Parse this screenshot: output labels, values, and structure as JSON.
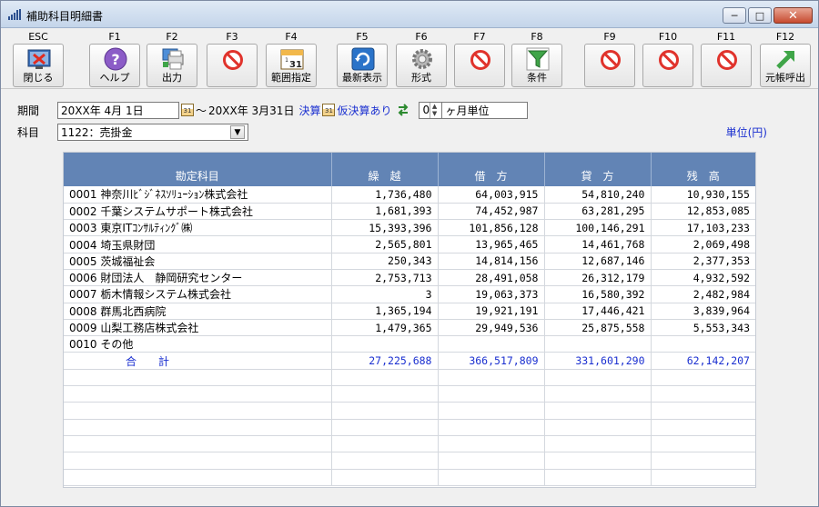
{
  "window": {
    "title": "補助科目明細書",
    "controls": {
      "minimize": "─",
      "maximize": "□",
      "close": "✕"
    }
  },
  "toolbar": [
    {
      "key": "ESC",
      "label": "閉じる",
      "icon": "close-window-icon"
    },
    {
      "key": "F1",
      "label": "ヘルプ",
      "icon": "help-icon"
    },
    {
      "key": "F2",
      "label": "出力",
      "icon": "print-output-icon"
    },
    {
      "key": "F3",
      "label": "",
      "icon": "disabled-icon"
    },
    {
      "key": "F4",
      "label": "範囲指定",
      "icon": "calendar-range-icon"
    },
    {
      "key": "F5",
      "label": "最新表示",
      "icon": "refresh-icon"
    },
    {
      "key": "F6",
      "label": "形式",
      "icon": "gear-format-icon"
    },
    {
      "key": "F7",
      "label": "",
      "icon": "disabled-icon"
    },
    {
      "key": "F8",
      "label": "条件",
      "icon": "filter-condition-icon"
    },
    {
      "key": "F9",
      "label": "",
      "icon": "disabled-icon"
    },
    {
      "key": "F10",
      "label": "",
      "icon": "disabled-icon"
    },
    {
      "key": "F11",
      "label": "",
      "icon": "disabled-icon"
    },
    {
      "key": "F12",
      "label": "元帳呼出",
      "icon": "ledger-call-icon"
    }
  ],
  "filters": {
    "period_label": "期間",
    "period_from": "20XX年 4月 1日",
    "period_sep": "～",
    "period_to": "20XX年 3月31日",
    "settle_label": "決算",
    "provisional_label": "仮決算あり",
    "months_value": "0",
    "months_unit": "ヶ月単位",
    "account_label": "科目",
    "account_value": "1122：売掛金",
    "unit_label": "単位(円)"
  },
  "table": {
    "headers": [
      "勘定科目",
      "繰　越",
      "借　方",
      "貸　方",
      "残　高"
    ],
    "rows": [
      [
        "0001 神奈川ﾋﾞｼﾞﾈｽｿﾘｭｰｼｮﾝ株式会社",
        "1,736,480",
        "64,003,915",
        "54,810,240",
        "10,930,155"
      ],
      [
        "0002 千葉システムサポート株式会社",
        "1,681,393",
        "74,452,987",
        "63,281,295",
        "12,853,085"
      ],
      [
        "0003 東京ITｺﾝｻﾙﾃｨﾝｸﾞ㈱",
        "15,393,396",
        "101,856,128",
        "100,146,291",
        "17,103,233"
      ],
      [
        "0004 埼玉県財団",
        "2,565,801",
        "13,965,465",
        "14,461,768",
        "2,069,498"
      ],
      [
        "0005 茨城福祉会",
        "250,343",
        "14,814,156",
        "12,687,146",
        "2,377,353"
      ],
      [
        "0006 財団法人　静岡研究センター",
        "2,753,713",
        "28,491,058",
        "26,312,179",
        "4,932,592"
      ],
      [
        "0007 栃木情報システム株式会社",
        "3",
        "19,063,373",
        "16,580,392",
        "2,482,984"
      ],
      [
        "0008 群馬北西病院",
        "1,365,194",
        "19,921,191",
        "17,446,421",
        "3,839,964"
      ],
      [
        "0009 山梨工務店株式会社",
        "1,479,365",
        "29,949,536",
        "25,875,558",
        "5,553,343"
      ],
      [
        "0010 その他",
        "",
        "",
        "",
        ""
      ]
    ],
    "total": [
      "合　　計",
      "27,225,688",
      "366,517,809",
      "331,601,290",
      "62,142,207"
    ]
  }
}
